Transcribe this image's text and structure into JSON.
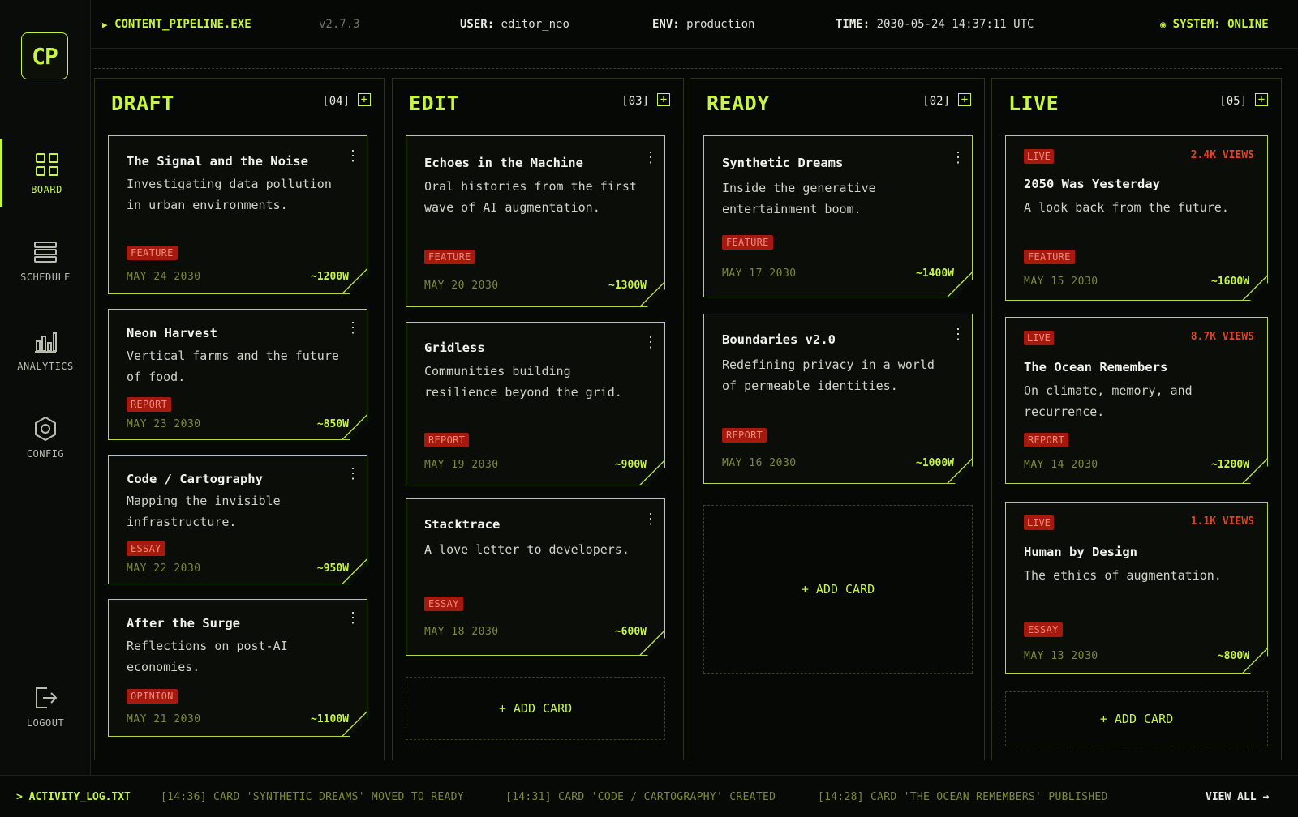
{
  "app": {
    "logo": "CP",
    "name": "CONTENT_PIPELINE.EXE",
    "version": "v2.7.3",
    "user_key": "USER:",
    "user_val": "editor_neo",
    "env_key": "ENV:",
    "env_val": "production",
    "time_key": "TIME:",
    "time_val": "2030-05-24 14:37:11 UTC",
    "system": "SYSTEM: ONLINE"
  },
  "nav": {
    "board": "BOARD",
    "schedule": "SCHEDULE",
    "analytics": "ANALYTICS",
    "config": "CONFIG",
    "logout": "LOGOUT"
  },
  "columns": {
    "draft": {
      "title": "DRAFT",
      "count": "[04]",
      "cards": [
        {
          "title": "The Signal and the Noise",
          "desc": "Investigating data pollution in urban environments.",
          "tag": "FEATURE",
          "date": "MAY 24 2030",
          "words": "~1200W"
        },
        {
          "title": "Neon Harvest",
          "desc": "Vertical farms and the future of food.",
          "tag": "REPORT",
          "date": "MAY 23 2030",
          "words": "~850W"
        },
        {
          "title": "Code / Cartography",
          "desc": "Mapping the invisible infrastructure.",
          "tag": "ESSAY",
          "date": "MAY 22 2030",
          "words": "~950W"
        },
        {
          "title": "After the Surge",
          "desc": "Reflections on post-AI economies.",
          "tag": "OPINION",
          "date": "MAY 21 2030",
          "words": "~1100W"
        }
      ]
    },
    "edit": {
      "title": "EDIT",
      "count": "[03]",
      "add_card": "+ ADD CARD",
      "cards": [
        {
          "title": "Echoes in the Machine",
          "desc": "Oral histories from the first wave of AI augmentation.",
          "tag": "FEATURE",
          "date": "MAY 20 2030",
          "words": "~1300W"
        },
        {
          "title": "Gridless",
          "desc": "Communities building resilience beyond the grid.",
          "tag": "REPORT",
          "date": "MAY 19 2030",
          "words": "~900W"
        },
        {
          "title": "Stacktrace",
          "desc": "A love letter to developers.",
          "tag": "ESSAY",
          "date": "MAY 18 2030",
          "words": "~600W"
        }
      ]
    },
    "ready": {
      "title": "READY",
      "count": "[02]",
      "add_card": "+ ADD CARD",
      "cards": [
        {
          "title": "Synthetic Dreams",
          "desc": "Inside the generative entertainment boom.",
          "tag": "FEATURE",
          "date": "MAY 17 2030",
          "words": "~1400W"
        },
        {
          "title": "Boundaries v2.0",
          "desc": "Redefining privacy in a world of permeable identities.",
          "tag": "REPORT",
          "date": "MAY 16 2030",
          "words": "~1000W"
        }
      ]
    },
    "live": {
      "title": "LIVE",
      "count": "[05]",
      "add_card": "+ ADD CARD",
      "cards": [
        {
          "badge": "LIVE",
          "views": "2.4K VIEWS",
          "title": "2050 Was Yesterday",
          "desc": "A look back from the future.",
          "tag": "FEATURE",
          "date": "MAY 15 2030",
          "words": "~1600W"
        },
        {
          "badge": "LIVE",
          "views": "8.7K VIEWS",
          "title": "The Ocean Remembers",
          "desc": "On climate, memory, and recurrence.",
          "tag": "REPORT",
          "date": "MAY 14 2030",
          "words": "~1200W"
        },
        {
          "badge": "LIVE",
          "views": "1.1K VIEWS",
          "title": "Human by Design",
          "desc": "The ethics of augmentation.",
          "tag": "ESSAY",
          "date": "MAY 13 2030",
          "words": "~800W"
        }
      ]
    }
  },
  "log": {
    "title": "> ACTIVITY_LOG.TXT",
    "entries": [
      "[14:36] CARD 'SYNTHETIC DREAMS' MOVED TO READY",
      "[14:31] CARD 'CODE / CARTOGRAPHY' CREATED",
      "[14:28] CARD 'THE OCEAN REMEMBERS' PUBLISHED"
    ],
    "view_all": "VIEW ALL →"
  },
  "colors": {
    "accent": "#c8f542",
    "tag_bg": "#a5190f",
    "views": "#e0441f",
    "background": "#060805"
  },
  "icons": {
    "app": "play-triangle-icon",
    "system": "status-dot-icon",
    "board": "grid-icon",
    "schedule": "list-icon",
    "analytics": "bar-chart-icon",
    "config": "gear-icon",
    "logout": "logout-icon",
    "column_add": "plus-box-icon",
    "card_menu": "kebab-menu-icon"
  }
}
